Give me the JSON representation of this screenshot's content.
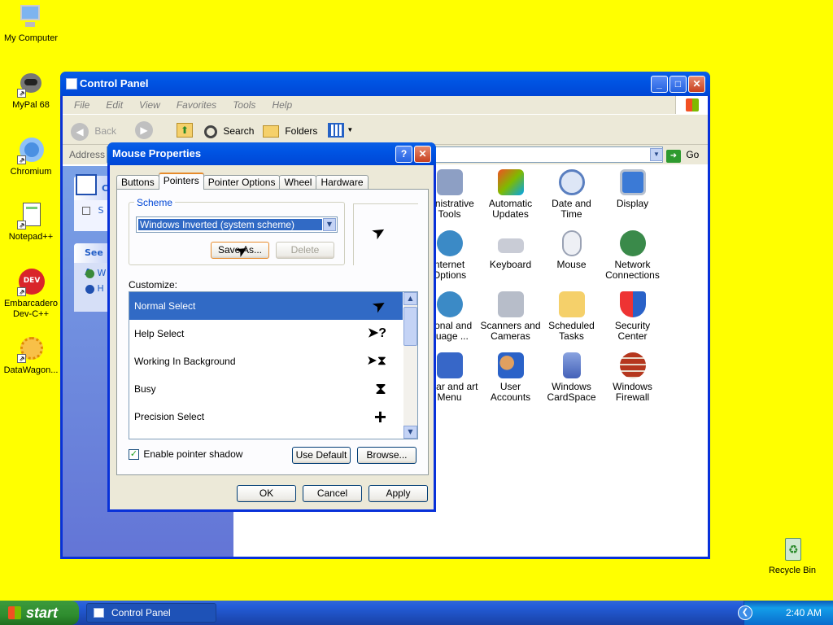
{
  "desktop": {
    "icons": [
      {
        "label": "My Computer",
        "icon": "computer-icon"
      },
      {
        "label": "MyPal 68",
        "icon": "raccoon-icon"
      },
      {
        "label": "Chromium",
        "icon": "chromium-icon"
      },
      {
        "label": "Notepad++",
        "icon": "notepad-icon"
      },
      {
        "label": "Embarcadero Dev-C++",
        "icon": "devcpp-icon"
      },
      {
        "label": "DataWagon...",
        "icon": "sun-icon"
      },
      {
        "label": "Recycle Bin",
        "icon": "recycle-bin-icon"
      }
    ]
  },
  "control_panel": {
    "title": "Control Panel",
    "menu": [
      "File",
      "Edit",
      "View",
      "Favorites",
      "Tools",
      "Help"
    ],
    "toolbar": {
      "back": "Back",
      "search": "Search",
      "folders": "Folders"
    },
    "address_label": "Address",
    "go_label": "Go",
    "sidebar": {
      "task1_prefix": "C",
      "task2_prefix": "S",
      "see_also": "See A",
      "link1": "W",
      "link2": "H"
    },
    "items": [
      {
        "label": "ministrative Tools",
        "icon": "admin-tools-icon"
      },
      {
        "label": "Automatic Updates",
        "icon": "windows-flag-icon"
      },
      {
        "label": "Date and Time",
        "icon": "clock-icon"
      },
      {
        "label": "Display",
        "icon": "display-icon"
      },
      {
        "label": "nternet Options",
        "icon": "globe-icon"
      },
      {
        "label": "Keyboard",
        "icon": "keyboard-icon"
      },
      {
        "label": "Mouse",
        "icon": "mouse-icon"
      },
      {
        "label": "Network Connections",
        "icon": "network-icon"
      },
      {
        "label": "gional and guage ...",
        "icon": "regional-icon"
      },
      {
        "label": "Scanners and Cameras",
        "icon": "scanner-icon"
      },
      {
        "label": "Scheduled Tasks",
        "icon": "folder-clock-icon"
      },
      {
        "label": "Security Center",
        "icon": "shield-icon"
      },
      {
        "label": "skbar and art Menu",
        "icon": "taskbar-icon"
      },
      {
        "label": "User Accounts",
        "icon": "users-icon"
      },
      {
        "label": "Windows CardSpace",
        "icon": "cardspace-icon"
      },
      {
        "label": "Windows Firewall",
        "icon": "firewall-icon"
      }
    ]
  },
  "mouse_dialog": {
    "title": "Mouse Properties",
    "tabs": [
      "Buttons",
      "Pointers",
      "Pointer Options",
      "Wheel",
      "Hardware"
    ],
    "active_tab": "Pointers",
    "scheme_label": "Scheme",
    "scheme_value": "Windows Inverted (system scheme)",
    "save_as": "Save As...",
    "delete": "Delete",
    "customize_label": "Customize:",
    "cursors": [
      {
        "label": "Normal Select",
        "glyph": "➤"
      },
      {
        "label": "Help Select",
        "glyph": "➤?"
      },
      {
        "label": "Working In Background",
        "glyph": "➤⧗"
      },
      {
        "label": "Busy",
        "glyph": "⧗"
      },
      {
        "label": "Precision Select",
        "glyph": "+"
      }
    ],
    "shadow_label": "Enable pointer shadow",
    "shadow_checked": true,
    "use_default": "Use Default",
    "browse": "Browse...",
    "ok": "OK",
    "cancel": "Cancel",
    "apply": "Apply",
    "help_glyph": "?",
    "close_glyph": "✕"
  },
  "taskbar": {
    "start": "start",
    "task": "Control Panel",
    "clock": "2:40 AM"
  }
}
